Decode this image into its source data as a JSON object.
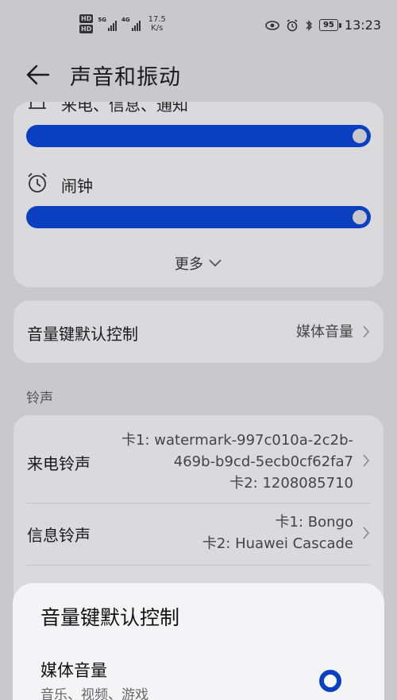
{
  "status_bar": {
    "hd1": "HD",
    "hd2": "HD",
    "net1": "5G",
    "net2": "4G",
    "speed_value": "17.5",
    "speed_unit": "K/s",
    "battery": "95",
    "time": "13:23"
  },
  "header": {
    "title": "声音和振动"
  },
  "volume_card": {
    "partial_label": "来电、信息、通知",
    "alarm_label": "闹钟",
    "more_label": "更多"
  },
  "volume_key": {
    "title": "音量键默认控制",
    "value": "媒体音量"
  },
  "section": {
    "ringtone_label": "铃声"
  },
  "ringtones": {
    "call": {
      "title": "来电铃声",
      "line1": "卡1: watermark-997c010a-2c2b-",
      "line2": "469b-b9cd-5ecb0cf62fa7",
      "line3": "卡2: 1208085710"
    },
    "message": {
      "title": "信息铃声",
      "line1": "卡1: Bongo",
      "line2": "卡2: Huawei Cascade"
    }
  },
  "sheet": {
    "title": "音量键默认控制",
    "option_title": "媒体音量",
    "option_sub": "音乐、视频、游戏"
  },
  "colors": {
    "accent": "#0a3fc2",
    "background": "#c9c9cb",
    "card": "#dadadc",
    "sheet": "#f4f4f6"
  },
  "icons": {
    "back": "arrow-left-icon",
    "bell": "bell-icon",
    "alarm": "alarm-clock-icon",
    "chevron_down": "chevron-down-icon",
    "chevron_right": "chevron-right-icon",
    "eye": "eye-icon",
    "alarm_status": "alarm-status-icon",
    "bluetooth": "bluetooth-icon"
  }
}
